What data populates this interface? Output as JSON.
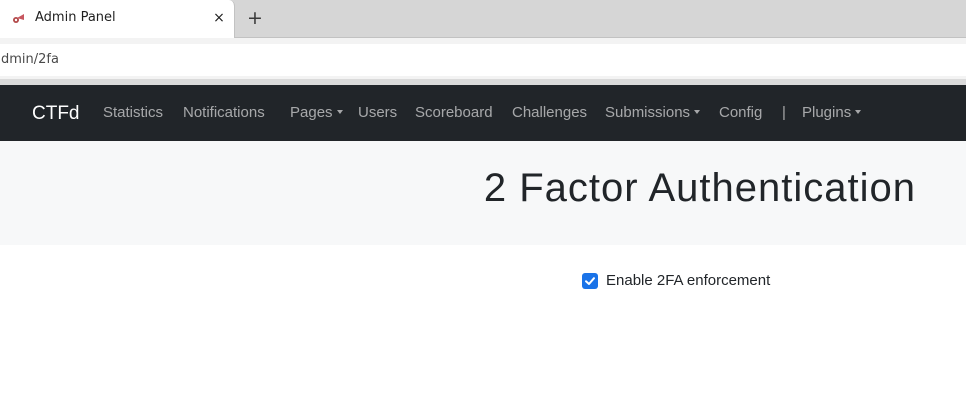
{
  "browser": {
    "tab": {
      "title": "Admin Panel",
      "close_glyph": "×",
      "favicon": "ctfd-favicon"
    },
    "new_tab_glyph": "+",
    "address_bar": {
      "url": "dmin/2fa"
    }
  },
  "navbar": {
    "brand": "CTFd",
    "items": [
      {
        "label": "Statistics"
      },
      {
        "label": "Notifications"
      },
      {
        "label": "Pages"
      },
      {
        "label": "Users"
      },
      {
        "label": "Scoreboard"
      },
      {
        "label": "Challenges"
      },
      {
        "label": "Submissions"
      },
      {
        "label": "Config"
      },
      {
        "label": "|"
      },
      {
        "label": "Plugins"
      }
    ]
  },
  "page": {
    "title": "2 Factor Authentication",
    "enforcement": {
      "label": "Enable 2FA enforcement",
      "checked": true
    }
  },
  "colors": {
    "navbar_bg": "#212529",
    "jumbotron_bg": "#f7f8f9",
    "checkbox_accent": "#1a73e8"
  }
}
